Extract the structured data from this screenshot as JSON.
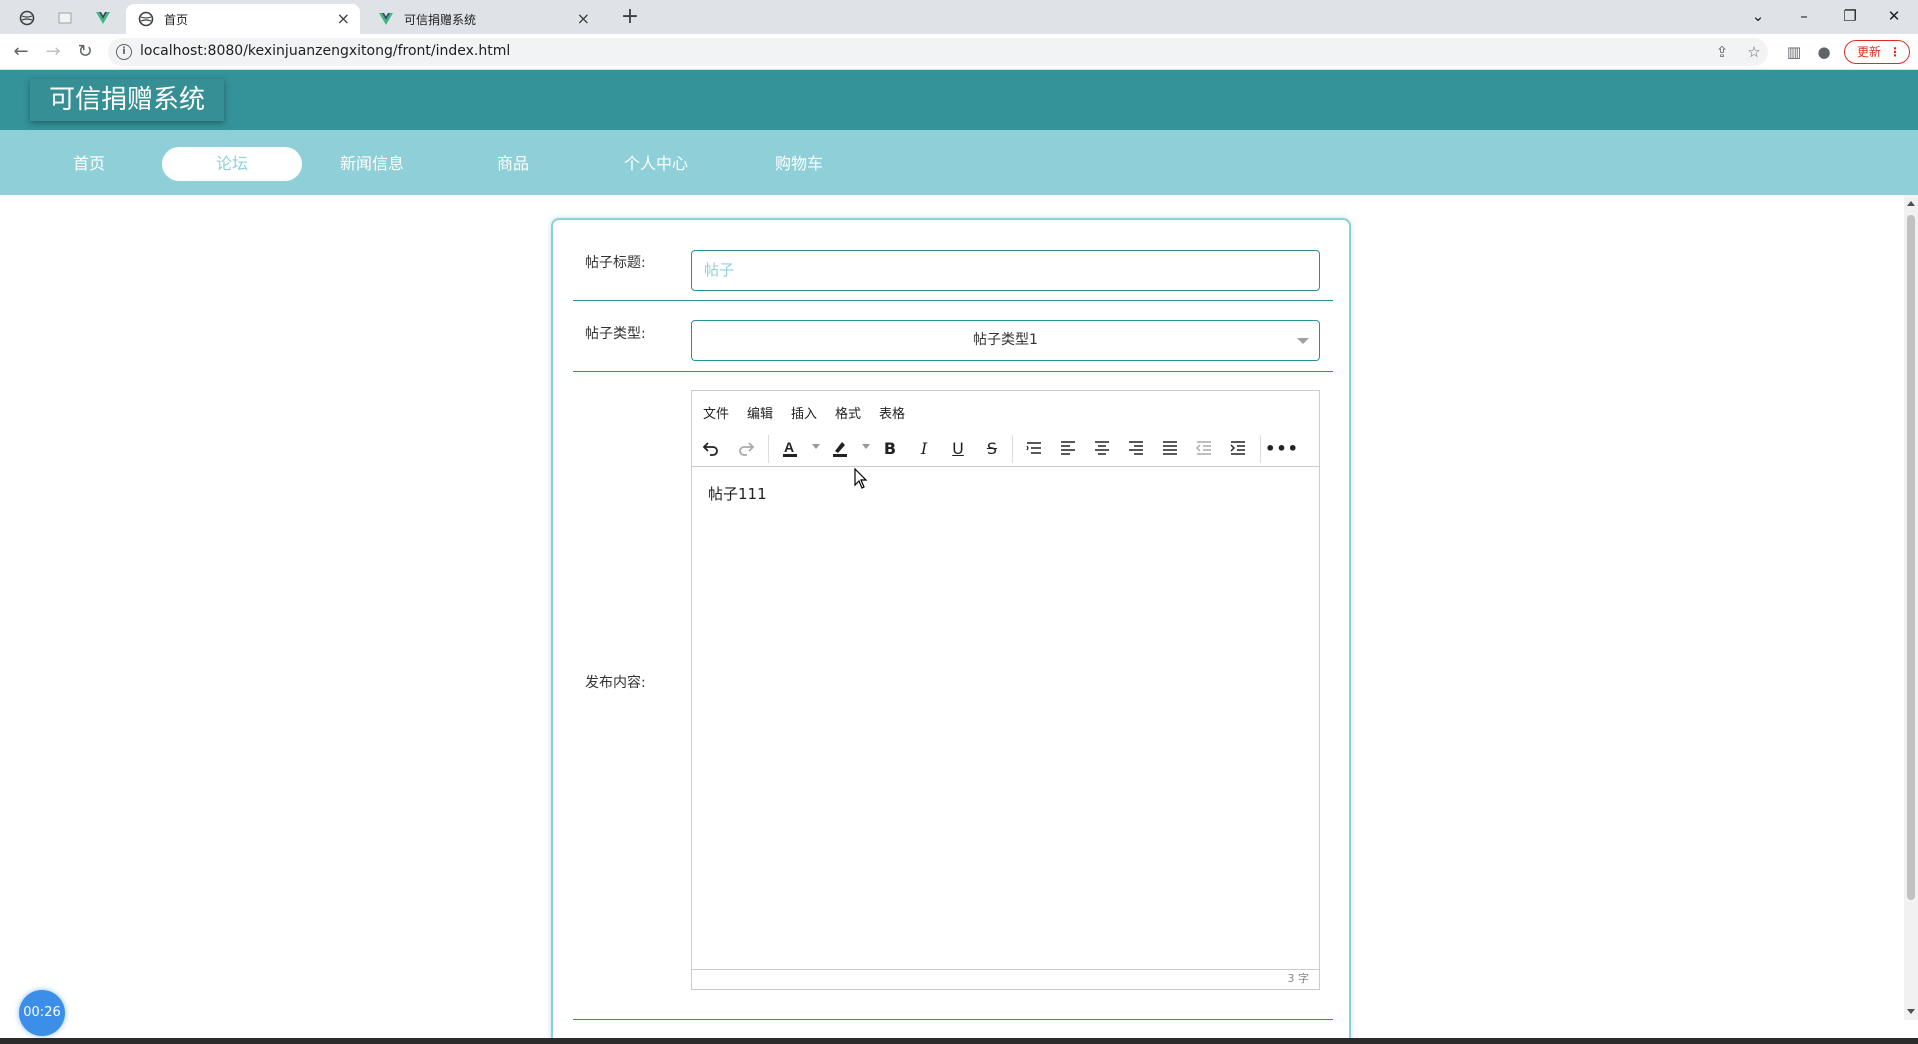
{
  "browser": {
    "tabs": [
      {
        "title": "首页",
        "active": true
      },
      {
        "title": "可信捐赠系统",
        "active": false
      }
    ],
    "url": "localhost:8080/kexinjuanzengxitong/front/index.html",
    "update_label": "更新"
  },
  "site": {
    "title": "可信捐赠系统",
    "nav": [
      {
        "label": "首页",
        "active": false
      },
      {
        "label": "论坛",
        "active": true
      },
      {
        "label": "新闻信息",
        "active": false
      },
      {
        "label": "商品",
        "active": false
      },
      {
        "label": "个人中心",
        "active": false
      },
      {
        "label": "购物车",
        "active": false
      }
    ]
  },
  "form": {
    "title_label": "帖子标题:",
    "title_placeholder": "帖子",
    "type_label": "帖子类型:",
    "type_value": "帖子类型1",
    "content_label": "发布内容:"
  },
  "editor": {
    "menus": [
      "文件",
      "编辑",
      "插入",
      "格式",
      "表格"
    ],
    "content": "帖子111",
    "word_count": "3 字"
  },
  "timer": "00:26",
  "colors": {
    "header_bg": "#349299",
    "nav_bg": "#8fd0d8",
    "accent": "#2b8f98",
    "timer_bg": "#3b8fe8"
  }
}
